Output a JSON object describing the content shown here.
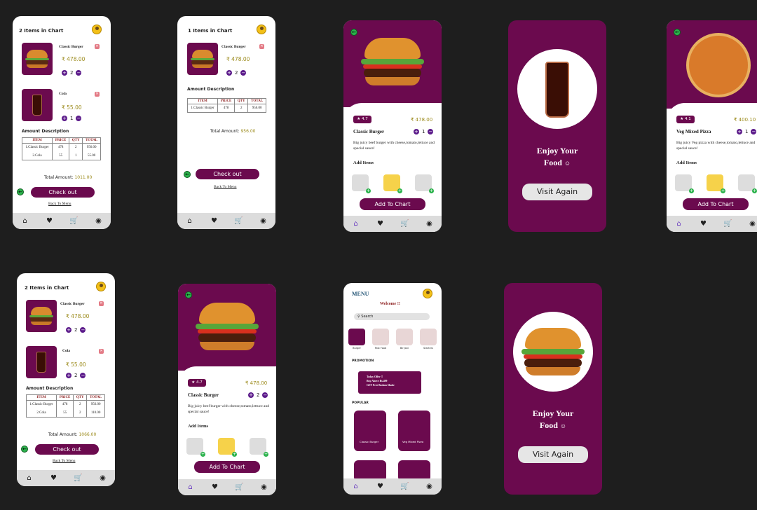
{
  "cart": {
    "title_two": "2 Items in Chart",
    "title_one": "1 Items in Chart",
    "item1_name": "Classic Burger",
    "item1_price": "₹ 478.00",
    "item2_name": "Cola",
    "item2_price": "₹ 55.00",
    "qty_one": "1",
    "qty_two": "2",
    "amount_desc": "Amount Description",
    "th_item": "ITEM",
    "th_price": "PRICE",
    "th_qty": "QTY",
    "th_total": "TOTAL",
    "r1_item": "1.Classic Burger",
    "r1_price": "478",
    "r1_qty": "2",
    "r1_total": "956.00",
    "r2_item": "2.Cola",
    "r2_price": "55",
    "r2_qty1": "1",
    "r2_total1": "55.00",
    "r2_qty2": "2",
    "r2_total2": "110.00",
    "total_label": "Total Amount:",
    "total_a": "1011.00",
    "total_b": "956.00",
    "total_c": "1066.00",
    "checkout": "Check out",
    "back_menu": "Back To Menu"
  },
  "detail": {
    "rating_burger": "4.7",
    "rating_pizza": "4.1",
    "burger_name": "Classic Burger",
    "burger_price": "₹ 478.00",
    "burger_desc": "Big juicy beef burger with cheese,tomato,lettuce and special sauce!",
    "pizza_name": "Veg Mixed Pizza",
    "pizza_price": "₹ 400.10",
    "pizza_desc": "Big juicy Veg pizza with cheese,tomato,lettuce and special sauce!",
    "add_items": "Add Items",
    "add_to_chart": "Add To Chart",
    "qty1": "1",
    "qty2": "2"
  },
  "enjoy": {
    "line1": "Enjoy Your",
    "line2": "Food",
    "visit_again": "Visit Again"
  },
  "menu": {
    "title": "MENU",
    "welcome": "Welcome !!",
    "search_placeholder": "Search",
    "categories": [
      "Burger",
      "Fast Food",
      "Biryani",
      "Starters"
    ],
    "promotion": "PROMOTION",
    "promo_line1": "Today Offer !!",
    "promo_line2": "Buy Above Rs.499",
    "promo_line3": "GET Free Badam Shake",
    "popular": "POPULAR",
    "pop1_name": "Classic Burger",
    "pop2_name": "Veg Mixed Pizza"
  },
  "nav": {
    "home_icon": "home-icon",
    "fav_icon": "heart-icon",
    "cart_icon": "cart-icon",
    "profile_icon": "profile-icon"
  }
}
